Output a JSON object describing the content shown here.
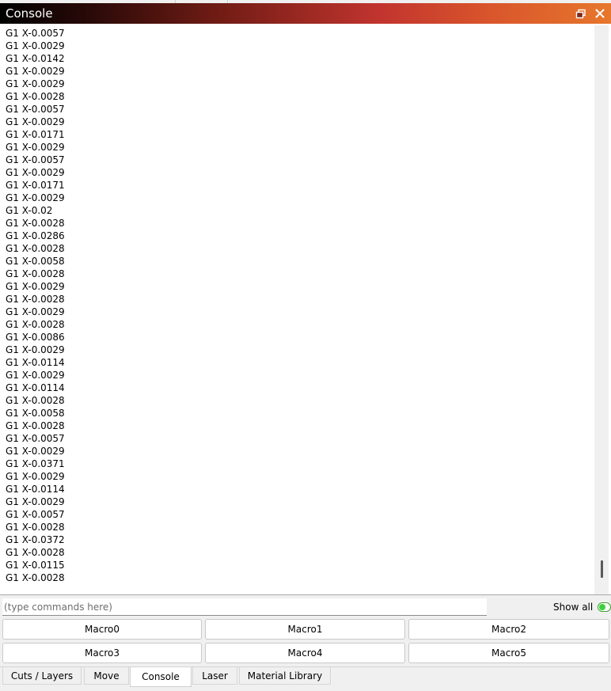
{
  "window": {
    "title": "Console",
    "float_icon": "restore-window-icon",
    "close_icon": "close-icon"
  },
  "console": {
    "lines": [
      "G1 X-0.0057",
      "G1 X-0.0029",
      "G1 X-0.0142",
      "G1 X-0.0029",
      "G1 X-0.0029",
      "G1 X-0.0028",
      "G1 X-0.0057",
      "G1 X-0.0029",
      "G1 X-0.0171",
      "G1 X-0.0029",
      "G1 X-0.0057",
      "G1 X-0.0029",
      "G1 X-0.0171",
      "G1 X-0.0029",
      "G1 X-0.02",
      "G1 X-0.0028",
      "G1 X-0.0286",
      "G1 X-0.0028",
      "G1 X-0.0058",
      "G1 X-0.0028",
      "G1 X-0.0029",
      "G1 X-0.0028",
      "G1 X-0.0029",
      "G1 X-0.0028",
      "G1 X-0.0086",
      "G1 X-0.0029",
      "G1 X-0.0114",
      "G1 X-0.0029",
      "G1 X-0.0114",
      "G1 X-0.0028",
      "G1 X-0.0058",
      "G1 X-0.0028",
      "G1 X-0.0057",
      "G1 X-0.0029",
      "G1 X-0.0371",
      "G1 X-0.0029",
      "G1 X-0.0114",
      "G1 X-0.0029",
      "G1 X-0.0057",
      "G1 X-0.0028",
      "G1 X-0.0372",
      "G1 X-0.0028",
      "G1 X-0.0115",
      "G1 X-0.0028"
    ]
  },
  "command": {
    "placeholder": "(type commands here)",
    "value": "",
    "show_all_label": "Show all",
    "show_all_on": true
  },
  "macros": [
    "Macro0",
    "Macro1",
    "Macro2",
    "Macro3",
    "Macro4",
    "Macro5"
  ],
  "tabs": [
    {
      "label": "Cuts / Layers",
      "active": false
    },
    {
      "label": "Move",
      "active": false
    },
    {
      "label": "Console",
      "active": true
    },
    {
      "label": "Laser",
      "active": false
    },
    {
      "label": "Material Library",
      "active": false
    }
  ],
  "colors": {
    "toggle_on": "#3cd13c",
    "title_gradient_end": "#e6772c"
  }
}
